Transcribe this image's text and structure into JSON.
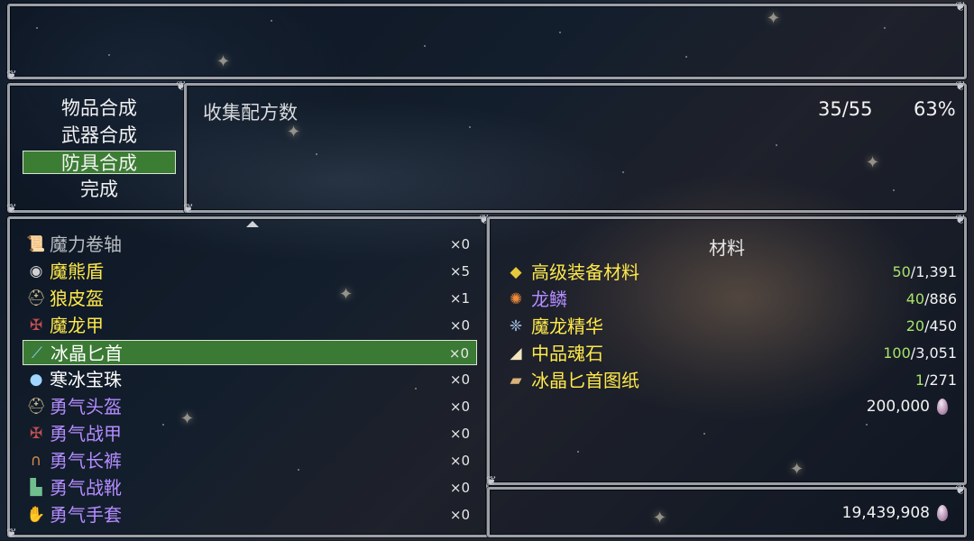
{
  "categories": [
    {
      "label": "物品合成",
      "selected": false
    },
    {
      "label": "武器合成",
      "selected": false
    },
    {
      "label": "防具合成",
      "selected": true
    },
    {
      "label": "完成",
      "selected": false
    }
  ],
  "header": {
    "label": "收集配方数",
    "count": "35/55",
    "percent": "63%"
  },
  "items": [
    {
      "name": "魔力卷轴",
      "qty": "×0",
      "color": "#b8bcc2",
      "icon": "scroll-icon",
      "selected": false
    },
    {
      "name": "魔熊盾",
      "qty": "×5",
      "color": "#ffe94a",
      "icon": "shield-icon",
      "selected": false
    },
    {
      "name": "狼皮盔",
      "qty": "×1",
      "color": "#ffe94a",
      "icon": "helmet-icon",
      "selected": false
    },
    {
      "name": "魔龙甲",
      "qty": "×0",
      "color": "#ffe94a",
      "icon": "armor-icon",
      "selected": false
    },
    {
      "name": "冰晶匕首",
      "qty": "×0",
      "color": "#ffffff",
      "icon": "dagger-icon",
      "selected": true
    },
    {
      "name": "寒冰宝珠",
      "qty": "×0",
      "color": "#ffffff",
      "icon": "orb-icon",
      "selected": false
    },
    {
      "name": "勇气头盔",
      "qty": "×0",
      "color": "#b48cff",
      "icon": "helmet-icon",
      "selected": false
    },
    {
      "name": "勇气战甲",
      "qty": "×0",
      "color": "#b48cff",
      "icon": "armor-icon",
      "selected": false
    },
    {
      "name": "勇气长裤",
      "qty": "×0",
      "color": "#b48cff",
      "icon": "pants-icon",
      "selected": false
    },
    {
      "name": "勇气战靴",
      "qty": "×0",
      "color": "#b48cff",
      "icon": "boots-icon",
      "selected": false
    },
    {
      "name": "勇气手套",
      "qty": "×0",
      "color": "#b48cff",
      "icon": "gloves-icon",
      "selected": false
    }
  ],
  "materials": {
    "title": "材料",
    "rows": [
      {
        "name": "高级装备材料",
        "need": "50",
        "have": "/1,391",
        "color": "#ffe94a",
        "icon": "ore-icon"
      },
      {
        "name": "龙鳞",
        "need": "40",
        "have": "/886",
        "color": "#b48cff",
        "icon": "scale-icon"
      },
      {
        "name": "魔龙精华",
        "need": "20",
        "have": "/450",
        "color": "#ffe94a",
        "icon": "essence-icon"
      },
      {
        "name": "中品魂石",
        "need": "100",
        "have": "/3,051",
        "color": "#ffe94a",
        "icon": "soulstone-icon"
      },
      {
        "name": "冰晶匕首图纸",
        "need": "1",
        "have": "/271",
        "color": "#ffe94a",
        "icon": "blueprint-icon"
      }
    ],
    "cost": "200,000"
  },
  "gold": "19,439,908",
  "colors": {
    "need_green": "#a6e36a",
    "selection_green": "#3c7d34"
  }
}
